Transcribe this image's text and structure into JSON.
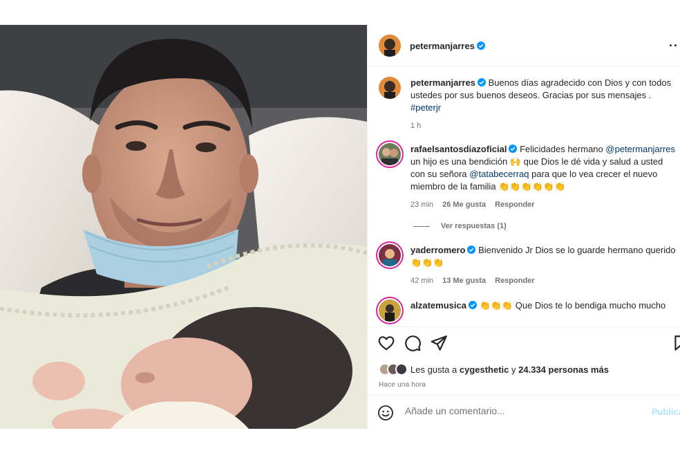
{
  "post": {
    "author": "petermanjarres",
    "caption_author": "petermanjarres",
    "caption": "Buenos días agradecido con Dios y con todos ustedes por sus buenos deseos. Gracias por sus mensajes .",
    "hashtag": "#peterjr",
    "caption_time": "1 h"
  },
  "comments": [
    {
      "username": "rafaelsantosdiazoficial",
      "text_1": "Felicidades hermano",
      "mention_1": "@petermanjarres",
      "text_2": "un hijo es una bendición 🙌 que Dios le dé vida y salud a usted con su señora",
      "mention_2": "@tatabecerraq",
      "text_3": "para que lo vea crecer el nuevo miembro de la familia 👏👏👏👏👏👏",
      "time": "23 min",
      "likes": "26 Me gusta",
      "reply": "Responder",
      "view_replies": "Ver respuestas (1)"
    },
    {
      "username": "yaderromero",
      "text": "Bienvenido Jr Dios se lo guarde hermano querido 👏👏👏",
      "time": "42 min",
      "likes": "13 Me gusta",
      "reply": "Responder"
    },
    {
      "username": "alzatemusica",
      "text": "👏👏👏 Que Dios te lo bendiga mucho mucho"
    }
  ],
  "likes": {
    "prefix": "Les gusta a",
    "user": "cygesthetic",
    "joiner": "y",
    "count": "24.334 personas más"
  },
  "posted_ago": "Hace una hora",
  "add_comment": {
    "placeholder": "Añade un comentario...",
    "publish": "Publica"
  },
  "icons": {
    "like": "heart-icon",
    "comment": "comment-icon",
    "share": "send-icon",
    "save": "bookmark-icon",
    "emoji": "emoji-icon",
    "more": "more-icon",
    "verified": "verified-badge-icon"
  },
  "colors": {
    "link": "#00376b",
    "verified": "#0095f6",
    "publish_disabled": "#b2dffc"
  }
}
